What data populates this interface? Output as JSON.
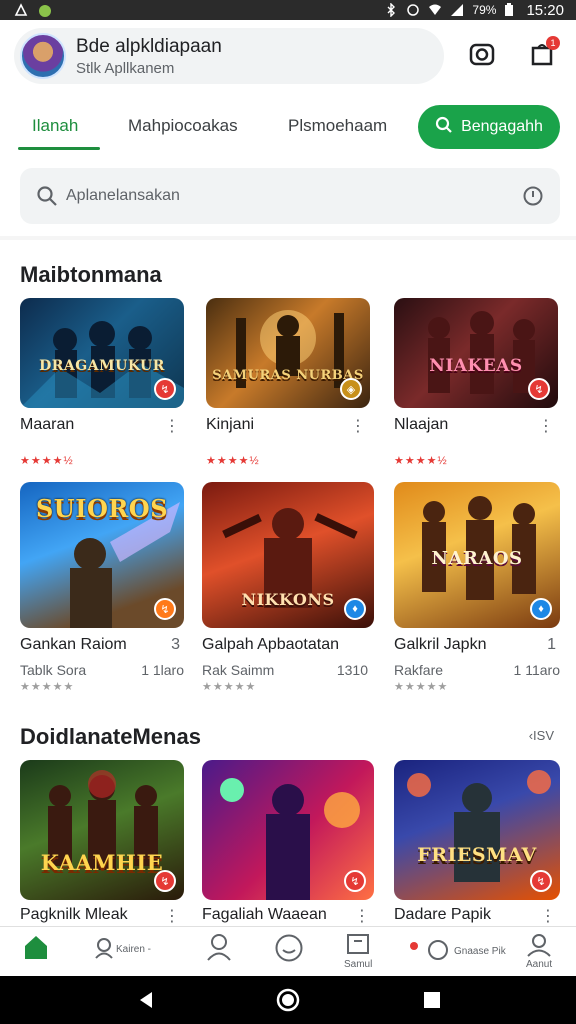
{
  "status_bar": {
    "battery": "79%",
    "time": "15:20"
  },
  "header": {
    "account_name": "Bde alpkldiapaan",
    "account_sub": "Stlk Apllkanem",
    "notif_badge": "1"
  },
  "tabs": {
    "items": [
      {
        "label": "Ilanah",
        "active": true
      },
      {
        "label": "Mahpiocoakas",
        "active": false
      },
      {
        "label": "Plsmoehaam",
        "active": false
      }
    ],
    "cta_label": "Bengagahh"
  },
  "search": {
    "placeholder": "Aplanelansakan"
  },
  "section1": {
    "title": "Maibtonmana",
    "row1": [
      {
        "name": "Maaran",
        "rating": "★★★★½",
        "thumb_title": "DRAGAMUKUR",
        "badge": "↯"
      },
      {
        "name": "Kinjani",
        "rating": "★★★★½",
        "thumb_title": "SAMURAS NURBAS",
        "badge": "◈"
      },
      {
        "name": "Nlaajan",
        "rating": "★★★★½",
        "thumb_title": "NIAKEAS",
        "badge": "↯"
      }
    ],
    "row2": [
      {
        "name": "Gankan Raiom",
        "count": "3",
        "meta": "Tablk Sora",
        "size": "1 1laro",
        "rating": "★★★★★",
        "thumb_title": "SUIOROS",
        "badge": "↯"
      },
      {
        "name": "Galpah Apbaotatan",
        "count": "",
        "meta": "Rak Saimm",
        "size": "1310",
        "rating": "★★★★★",
        "thumb_title": "NIKKONS",
        "badge": "♦"
      },
      {
        "name": "Galkril Japkn",
        "count": "1",
        "meta": "Rakfare",
        "size": "1 11aro",
        "rating": "★★★★★",
        "thumb_title": "NARAOS",
        "badge": "♦"
      }
    ]
  },
  "section2": {
    "title": "DoidlanateMenas",
    "see_more": "‹ISV",
    "items": [
      {
        "name": "Pagknilk Mleak",
        "thumb_title": "KAAMHIE",
        "badge": "↯"
      },
      {
        "name": "Fagaliah Waaean",
        "thumb_title": "",
        "badge": "↯"
      },
      {
        "name": "Dadare Papik",
        "thumb_title": "FRIESMAV",
        "badge": "↯"
      }
    ]
  },
  "bottom_nav": {
    "items": [
      {
        "label": ""
      },
      {
        "label": "Kairen -"
      },
      {
        "label": ""
      },
      {
        "label": ""
      },
      {
        "label": "Samul"
      },
      {
        "label": "Gnaase Pik"
      },
      {
        "label": "Aanut"
      }
    ]
  },
  "colors": {
    "accent": "#1aa34a",
    "badge": "#e53935"
  }
}
